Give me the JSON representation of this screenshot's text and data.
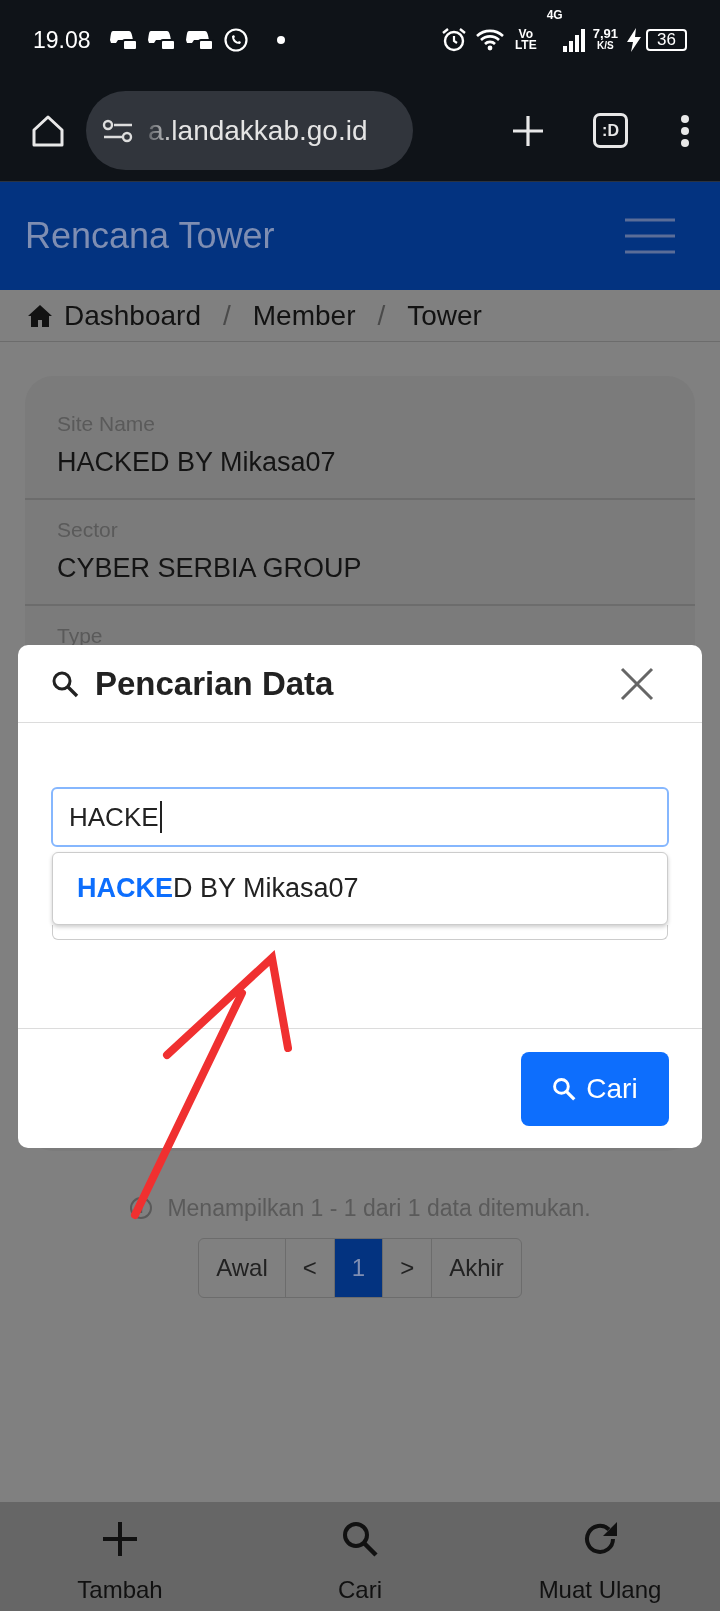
{
  "status_bar": {
    "time": "19.08",
    "volte": [
      "Vo",
      "LTE"
    ],
    "network": "4G",
    "speed": [
      "7,91",
      "K/S"
    ],
    "battery": "36"
  },
  "browser": {
    "url": "a.landakkab.go.id",
    "tab_count": ":D"
  },
  "header": {
    "title": "Rencana Tower"
  },
  "breadcrumb": {
    "items": [
      "Dashboard",
      "Member",
      "Tower"
    ],
    "separators": [
      "/",
      "/"
    ]
  },
  "card": {
    "fields": [
      {
        "label": "Site Name",
        "value": "HACKED BY Mikasa07"
      },
      {
        "label": "Sector",
        "value": "CYBER SERBIA GROUP"
      },
      {
        "label": "Type"
      }
    ]
  },
  "modal": {
    "title": "Pencarian Data",
    "search_value": "HACKE",
    "suggestions": [
      "**HACKE**D BY Mikasa07"
    ],
    "button": "Cari"
  },
  "result_info": "Menampilkan 1 - 1 dari 1 data ditemukan.",
  "pagination": [
    {
      "label": "Awal",
      "selected": false
    },
    {
      "label": "<",
      "selected": false
    },
    {
      "label": "1",
      "selected": true
    },
    {
      "label": ">",
      "selected": false
    },
    {
      "label": "Akhir",
      "selected": false
    }
  ],
  "bottom_nav": [
    {
      "label": "Tambah",
      "kind": "add"
    },
    {
      "label": "Cari",
      "kind": "search"
    },
    {
      "label": "Muat Ulang",
      "kind": "reload"
    }
  ]
}
